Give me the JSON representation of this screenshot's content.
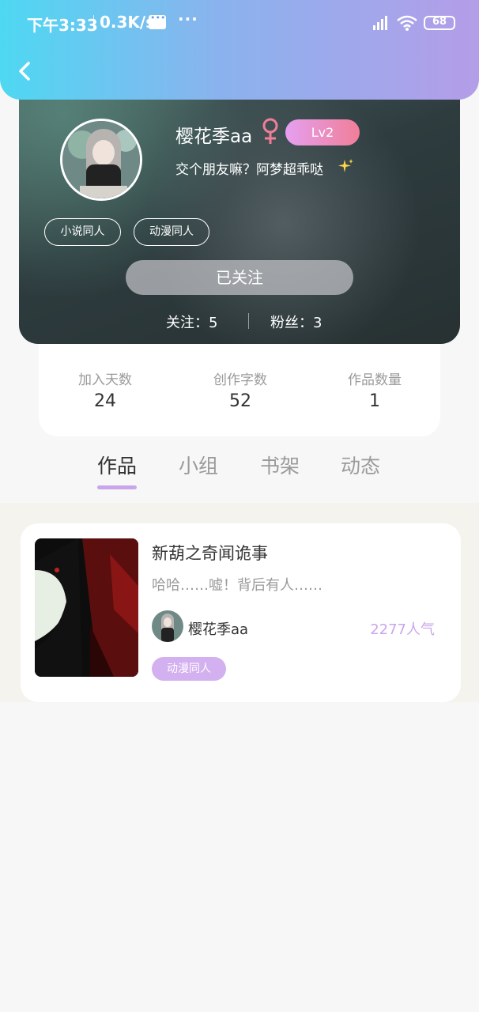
{
  "status_bar": {
    "time": "下午3:33",
    "net_speed": "0.3K/s",
    "more": "···",
    "battery": "68"
  },
  "profile": {
    "username": "樱花季aa",
    "level": "Lv2",
    "bio": "交个朋友嘛？阿梦超乖哒",
    "tags": [
      "小说同人",
      "动漫同人"
    ],
    "follow_button": "已关注",
    "following": "关注：5",
    "fans": "粉丝：3"
  },
  "stats": [
    {
      "label": "加入天数",
      "value": "24"
    },
    {
      "label": "创作字数",
      "value": "52"
    },
    {
      "label": "作品数量",
      "value": "1"
    }
  ],
  "tabs": [
    "作品",
    "小组",
    "书架",
    "动态"
  ],
  "works": [
    {
      "title": "新葫之奇闻诡事",
      "desc": "哈哈……嘘！背后有人……",
      "author": "樱花季aa",
      "popularity": "2277人气",
      "tag": "动漫同人"
    }
  ],
  "colors": {
    "header_gradient_start": "#4ed8f2",
    "header_gradient_end": "#b49de8",
    "accent_purple": "#c9a6ec",
    "level_badge_start": "#e5a0f0",
    "level_badge_end": "#f07e98",
    "gender_pink": "#f07e98"
  },
  "icons": [
    "back-icon",
    "female-icon",
    "sparkle-icon",
    "signal-icon",
    "wifi-icon",
    "battery-icon",
    "message-icon"
  ]
}
